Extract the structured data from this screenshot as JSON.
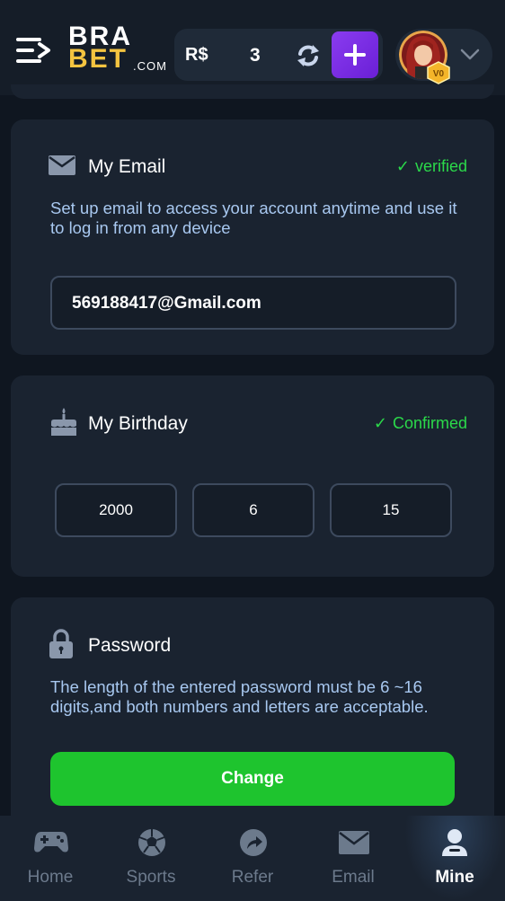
{
  "header": {
    "menu_icon": "menu-arrow-icon",
    "logo": {
      "top": "BRA",
      "bottom": "BET",
      "suffix": ".COM"
    },
    "balance": {
      "currency": "R$",
      "amount": "3"
    },
    "refresh_icon": "refresh-icon",
    "add_icon": "plus-icon",
    "vip_badge": "V0"
  },
  "email": {
    "title": "My Email",
    "status": "verified",
    "description": "Set up email to access your account anytime and use it to log in from any device",
    "value": "569188417@Gmail.com"
  },
  "birthday": {
    "title": "My Birthday",
    "status": "Confirmed",
    "year": "2000",
    "month": "6",
    "day": "15"
  },
  "password": {
    "title": "Password",
    "description": "The length of the entered password must be 6 ~16 digits,and both numbers and letters are acceptable.",
    "button": "Change"
  },
  "nav": [
    {
      "label": "Home",
      "icon": "gamepad-icon"
    },
    {
      "label": "Sports",
      "icon": "soccer-ball-icon"
    },
    {
      "label": "Refer",
      "icon": "share-icon"
    },
    {
      "label": "Email",
      "icon": "envelope-icon"
    },
    {
      "label": "Mine",
      "icon": "user-icon",
      "active": true
    }
  ],
  "colors": {
    "accent_green": "#1ec42e",
    "status_green": "#2bd94a",
    "add_purple": "#7a2de6",
    "logo_gold": "#f4c440"
  }
}
